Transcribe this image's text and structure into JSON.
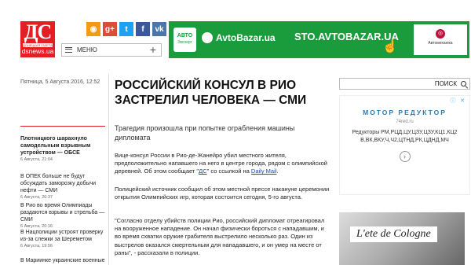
{
  "header": {
    "logo": {
      "letters": "ДС",
      "tagline": "ДОНЕЦКАЯ ГАЗЕТА",
      "site": "dsnews.ua"
    },
    "socials": [
      {
        "name": "rss-icon",
        "glyph": "◉",
        "color": "#f39c12"
      },
      {
        "name": "google-plus-icon",
        "glyph": "g+",
        "color": "#dd4b39"
      },
      {
        "name": "twitter-icon",
        "glyph": "t",
        "color": "#1da1f2"
      },
      {
        "name": "facebook-icon",
        "glyph": "f",
        "color": "#3b5998"
      },
      {
        "name": "vk-icon",
        "glyph": "vk",
        "color": "#4a76a8"
      }
    ],
    "menu_label": "МЕНЮ",
    "banner": {
      "badge": "АВТО",
      "badge_sub": "Эксперт",
      "text1": "AvtoBazar.ua",
      "text2": "STO.AVTOBAZAR.UA",
      "right_caption": "Автомеханіка"
    }
  },
  "article": {
    "date": "Пятница, 5 Августа 2016, 12:52",
    "headline": "РОССИЙСКИЙ КОНСУЛ В РИО ЗАСТРЕЛИЛ ЧЕЛОВЕКА — СМИ",
    "lead": "Трагедия произошла при попытке ограбления машины дипломата",
    "p1_before": "Вице-консул России в Рио-де-Жанейро убил местного жителя, предположительно напавшего на него в центре города, рядом с олимпийской деревней. Об этом сообщает \"",
    "p1_link1": "ДС",
    "p1_mid": "\" со ссылкой на ",
    "p1_link2": "Daily Mail",
    "p1_after": ".",
    "p2": "Полицейский источник сообщил об этом местной прессе накануне церемонии открытия Олимпийских игр, которая состоится сегодня, 5-го августа.",
    "p3": "\"Согласно отделу убийств полиции Рио, российский дипломат отреагировал на вооруженное нападение. Он начал физически бороться с нападавшим, и во время схватки оружие грабителя выстрелило несколько раз. Один из выстрелов оказался смертельным для нападавшего, и он умер на месте от раны\", - рассказали в полиции."
  },
  "sidebar_news": [
    {
      "title": "Плотницкого шарахнуло самодельным взрывным устройством — ОБСЕ",
      "date": "6 Августа, 21:04",
      "bold": true
    },
    {
      "title": "В ОПЕК больше не будут обсуждать заморозку добычи нефти — СМИ",
      "date": "6 Августа, 20:37",
      "bold": false
    },
    {
      "title": "В Рио во время Олимпиады раздаются взрывы и стрельба — СМИ",
      "date": "6 Августа, 20:16",
      "bold": false
    },
    {
      "title": "В Нацполиции устроят проверку из-за слежки за Шереметом",
      "date": "6 Августа, 19:56",
      "bold": false
    },
    {
      "title": "В Мариинке украинские военные",
      "date": "",
      "bold": false
    }
  ],
  "search": {
    "label": "ПОИСК"
  },
  "ad1": {
    "title": "МОТОР РЕДУКТОР",
    "site": "74red.ru",
    "body": "Редукторы РМ,РЦД,ЦУ,ЦЗУ,ЦЗУ,КЦ1,КЦ2 В,ВК,ВКУ,Ч,Ч2,ЦТНД,РК,ЦДНД,МЧ",
    "arrow": "›"
  },
  "ad2": {
    "label": "L'ete de Cologne"
  }
}
